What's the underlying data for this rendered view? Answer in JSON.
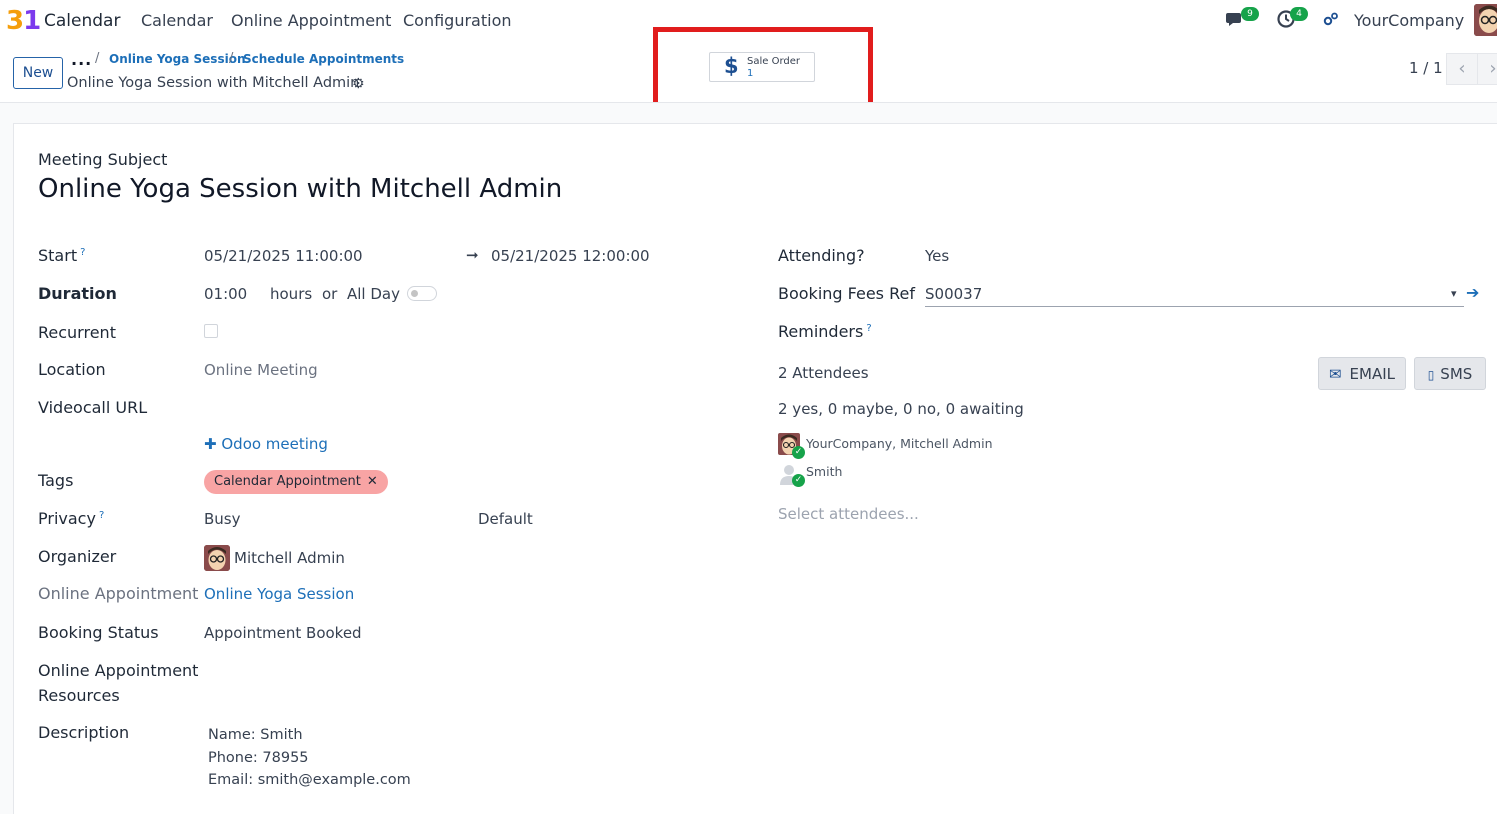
{
  "topnav": {
    "logo": {
      "d1": "3",
      "d2": "1"
    },
    "app_name": "Calendar",
    "menu": [
      "Calendar",
      "Online Appointment",
      "Configuration"
    ],
    "chat_badge": "9",
    "activity_badge": "4",
    "company": "YourCompany"
  },
  "control": {
    "new_label": "New",
    "breadcrumb_dots": "...",
    "breadcrumbs": [
      "Online Yoga Session",
      "Schedule Appointments"
    ],
    "record_title": "Online Yoga Session with Mitchell Admin",
    "smart_button": {
      "label": "Sale Order",
      "value": "1"
    },
    "pager": "1 / 1"
  },
  "form": {
    "subject_label": "Meeting Subject",
    "subject": "Online Yoga Session with Mitchell Admin",
    "start_label": "Start",
    "start": "05/21/2025 11:00:00",
    "stop": "05/21/2025 12:00:00",
    "duration_label": "Duration",
    "duration": "01:00",
    "hours_label": "hours",
    "or_label": "or",
    "allday_label": "All Day",
    "recurrent_label": "Recurrent",
    "location_label": "Location",
    "location": "Online Meeting",
    "videocall_label": "Videocall URL",
    "odoo_meeting": "Odoo meeting",
    "tags_label": "Tags",
    "tag": "Calendar Appointment",
    "privacy_label": "Privacy",
    "privacy": "Busy",
    "privacy_default": "Default",
    "organizer_label": "Organizer",
    "organizer": "Mitchell Admin",
    "appointment_label": "Online Appointment",
    "appointment": "Online Yoga Session",
    "booking_status_label": "Booking Status",
    "booking_status": "Appointment Booked",
    "resources_label_1": "Online Appointment",
    "resources_label_2": "Resources",
    "description_label": "Description",
    "description": [
      "Name: Smith",
      "Phone: 78955",
      "Email: smith@example.com"
    ],
    "attending_label": "Attending?",
    "attending": "Yes",
    "fees_label": "Booking Fees Ref",
    "fees": "S00037",
    "reminders_label": "Reminders",
    "attendees_count": "2 Attendees",
    "email_label": "EMAIL",
    "sms_label": "SMS",
    "attendees_summary": "2 yes, 0 maybe, 0 no, 0 awaiting",
    "attendees": [
      "YourCompany, Mitchell Admin",
      "Smith"
    ],
    "select_attendees": "Select attendees..."
  }
}
